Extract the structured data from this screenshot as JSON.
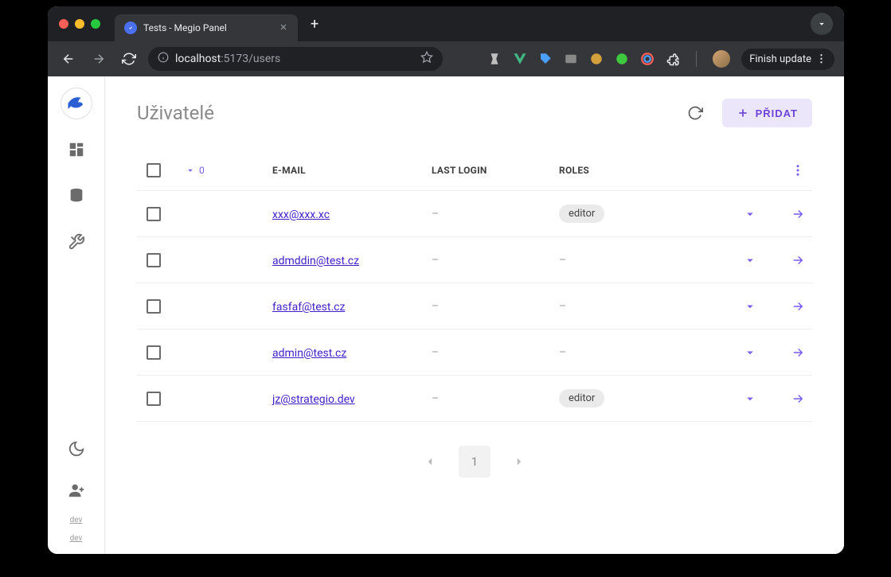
{
  "browser": {
    "tab_title": "Tests - Megio Panel",
    "url_host": "localhost",
    "url_port": ":5173",
    "url_path": "/users",
    "update_label": "Finish update"
  },
  "sidebar": {
    "bottom_labels": [
      "dev",
      "dev"
    ]
  },
  "page": {
    "title": "Uživatelé",
    "add_label": "PŘIDAT"
  },
  "table": {
    "selected_count": "0",
    "columns": {
      "email": "E-MAIL",
      "last_login": "LAST LOGIN",
      "roles": "ROLES"
    },
    "rows": [
      {
        "email": "xxx@xxx.xc",
        "last_login": "–",
        "roles": [
          "editor"
        ]
      },
      {
        "email": "admddin@test.cz",
        "last_login": "–",
        "roles": []
      },
      {
        "email": "fasfaf@test.cz",
        "last_login": "–",
        "roles": []
      },
      {
        "email": "admin@test.cz",
        "last_login": "–",
        "roles": []
      },
      {
        "email": "jz@strategio.dev",
        "last_login": "–",
        "roles": [
          "editor"
        ]
      }
    ]
  },
  "pagination": {
    "current": "1"
  }
}
